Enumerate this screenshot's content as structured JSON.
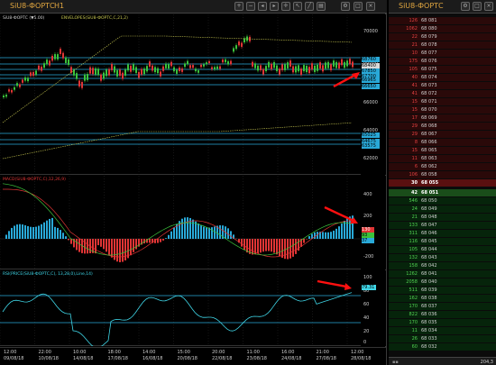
{
  "chart_window": {
    "title": "SiU8-ФОРТС",
    "timeframe": "H1",
    "price_pane": {
      "label_ticker": "SiU8-ФОРТС (▼5.00)",
      "label_envelopes": "ENVELOPES(SiU8-ФОРТС,C,21,2)",
      "price_axis": [
        "70000",
        "68000",
        "66000",
        "64000",
        "62000"
      ],
      "level_tags": [
        "68760",
        "68400",
        "67850",
        "67700",
        "66965",
        "66650",
        "65025",
        "64675",
        "63575"
      ]
    },
    "macd_pane": {
      "label": "MACD(SiU8-ФОРТС,C),12,26,9)",
      "axis": [
        "400",
        "200",
        "0",
        "-200"
      ],
      "value_tags": [
        "130",
        "93",
        "37"
      ]
    },
    "rsi_pane": {
      "label": "RSI(PRICE(SiU8-ФОРТС,C), 13,28,0),Line,14)",
      "axis": [
        "100",
        "80",
        "60",
        "40",
        "20",
        "0"
      ],
      "value_tag": "79.31"
    },
    "time_axis": {
      "times": [
        "12:00",
        "22:00",
        "10:00",
        "18:00",
        "14:00",
        "15:00",
        "20:00",
        "11:00",
        "16:00",
        "21:00",
        "12:00"
      ],
      "dates": [
        "09/08/18",
        "10/08/18",
        "14/08/18",
        "17/08/18",
        "16/08/18",
        "20/08/18",
        "22/08/18",
        "23/08/18",
        "24/08/18",
        "27/08/18",
        "28/08/18"
      ]
    }
  },
  "order_book": {
    "title": "SiU8-ФОРТС",
    "status": "204,3",
    "asks": [
      {
        "qty": "126",
        "price": "68 081"
      },
      {
        "qty": "1062",
        "price": "68 080"
      },
      {
        "qty": "22",
        "price": "68 079"
      },
      {
        "qty": "21",
        "price": "68 078"
      },
      {
        "qty": "10",
        "price": "68 077"
      },
      {
        "qty": "175",
        "price": "68 076"
      },
      {
        "qty": "105",
        "price": "68 075"
      },
      {
        "qty": "40",
        "price": "68 074"
      },
      {
        "qty": "41",
        "price": "68 073"
      },
      {
        "qty": "41",
        "price": "68 072"
      },
      {
        "qty": "15",
        "price": "68 071"
      },
      {
        "qty": "15",
        "price": "68 070"
      },
      {
        "qty": "17",
        "price": "68 069"
      },
      {
        "qty": "29",
        "price": "68 068"
      },
      {
        "qty": "29",
        "price": "68 067"
      },
      {
        "qty": "8",
        "price": "68 066"
      },
      {
        "qty": "15",
        "price": "68 065"
      },
      {
        "qty": "11",
        "price": "68 063"
      },
      {
        "qty": "6",
        "price": "68 062"
      },
      {
        "qty": "106",
        "price": "68 058"
      },
      {
        "qty": "30",
        "price": "68 055"
      }
    ],
    "bids": [
      {
        "qty": "42",
        "price": "68 051"
      },
      {
        "qty": "546",
        "price": "68 050"
      },
      {
        "qty": "24",
        "price": "68 049"
      },
      {
        "qty": "21",
        "price": "68 048"
      },
      {
        "qty": "133",
        "price": "68 047"
      },
      {
        "qty": "311",
        "price": "68 046"
      },
      {
        "qty": "116",
        "price": "68 045"
      },
      {
        "qty": "105",
        "price": "68 044"
      },
      {
        "qty": "132",
        "price": "68 043"
      },
      {
        "qty": "158",
        "price": "68 042"
      },
      {
        "qty": "1262",
        "price": "68 041"
      },
      {
        "qty": "2058",
        "price": "68 040"
      },
      {
        "qty": "511",
        "price": "68 039"
      },
      {
        "qty": "162",
        "price": "68 038"
      },
      {
        "qty": "170",
        "price": "68 037"
      },
      {
        "qty": "822",
        "price": "68 036"
      },
      {
        "qty": "170",
        "price": "68 035"
      },
      {
        "qty": "11",
        "price": "68 034"
      },
      {
        "qty": "26",
        "price": "68 033"
      },
      {
        "qty": "60",
        "price": "68 032"
      }
    ]
  },
  "colors": {
    "bull": "#3bc23b",
    "bear": "#e03535",
    "envelope": "#c8c850",
    "level": "#29a9d8",
    "rsi": "#3fd7e8",
    "macd_signal": "#e03535",
    "arrow": "#ff1010",
    "ask": "#e04040",
    "bid": "#52d052",
    "accent": "#e0a640"
  }
}
